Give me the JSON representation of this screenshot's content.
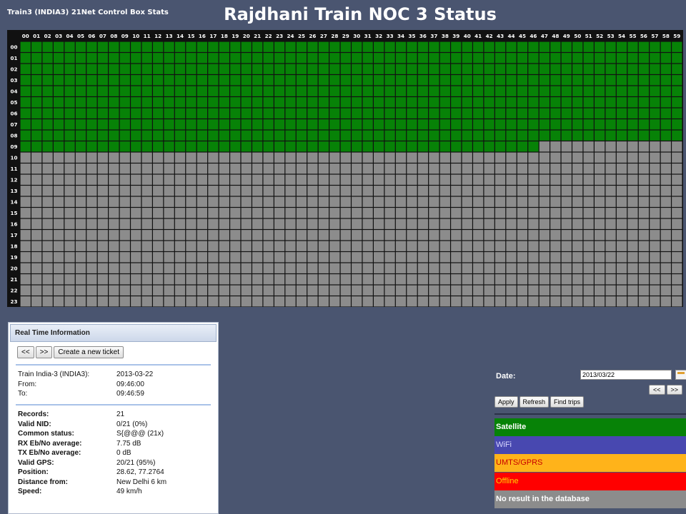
{
  "header": {
    "app_title": "Train3 (INDIA3) 21Net Control Box Stats",
    "slide_title": "Rajdhani Train NOC 3 Status"
  },
  "grid": {
    "minutes": [
      "00",
      "01",
      "02",
      "03",
      "04",
      "05",
      "06",
      "07",
      "08",
      "09",
      "10",
      "11",
      "12",
      "13",
      "14",
      "15",
      "16",
      "17",
      "18",
      "19",
      "20",
      "21",
      "22",
      "23",
      "24",
      "25",
      "26",
      "27",
      "28",
      "29",
      "30",
      "31",
      "32",
      "33",
      "34",
      "35",
      "36",
      "37",
      "38",
      "39",
      "40",
      "41",
      "42",
      "43",
      "44",
      "45",
      "46",
      "47",
      "48",
      "49",
      "50",
      "51",
      "52",
      "53",
      "54",
      "55",
      "56",
      "57",
      "58",
      "59"
    ],
    "hours": [
      "00",
      "01",
      "02",
      "03",
      "04",
      "05",
      "06",
      "07",
      "08",
      "09",
      "10",
      "11",
      "12",
      "13",
      "14",
      "15",
      "16",
      "17",
      "18",
      "19",
      "20",
      "21",
      "22",
      "23"
    ],
    "status_colors": {
      "satellite": "#078207",
      "no_result": "#8c8c8c",
      "wifi": "#4848b0",
      "umts": "#ffb31a",
      "offline": "#ff0000"
    },
    "satellite_full_hours": 9,
    "satellite_last_hour_minutes": 47
  },
  "realtime": {
    "header": "Real Time Information",
    "prev_label": "<<",
    "next_label": ">>",
    "ticket_label": "Create a new ticket",
    "train_label": "Train India-3 (INDIA3):",
    "train_value": "2013-03-22",
    "from_label": "From:",
    "from_value": "09:46:00",
    "to_label": "To:",
    "to_value": "09:46:59",
    "stats": [
      {
        "label": "Records:",
        "value": "21"
      },
      {
        "label": "Valid NID:",
        "value": "0/21 (0%)"
      },
      {
        "label": "Common status:",
        "value": "S{@@@ (21x)"
      },
      {
        "label": "RX Eb/No average:",
        "value": "7.75 dB"
      },
      {
        "label": "TX Eb/No average:",
        "value": "0 dB"
      },
      {
        "label": "Valid GPS:",
        "value": "20/21 (95%)"
      },
      {
        "label": "Position:",
        "value": "28.62, 77.2764"
      },
      {
        "label": "Distance from:",
        "value": "New Delhi 6 km"
      },
      {
        "label": "Speed:",
        "value": "49 km/h"
      }
    ]
  },
  "date_panel": {
    "date_label": "Date:",
    "date_value": "2013/03/22",
    "prev_label": "<<",
    "next_label": ">>",
    "apply_label": "Apply",
    "refresh_label": "Refresh",
    "find_trips_label": "Find trips"
  },
  "legend": [
    {
      "label": "Satellite",
      "bg": "#078207",
      "fg": "#ffffff",
      "bold": true
    },
    {
      "label": "WiFi",
      "bg": "#4848b0",
      "fg": "#d8d8ff",
      "bold": false
    },
    {
      "label": "UMTS/GPRS",
      "bg": "#ffb31a",
      "fg": "#c80000",
      "bold": false
    },
    {
      "label": "Offline",
      "bg": "#ff0000",
      "fg": "#ffd800",
      "bold": false
    },
    {
      "label": "No result in the database",
      "bg": "#8c8c8c",
      "fg": "#ffffff",
      "bold": true
    }
  ]
}
